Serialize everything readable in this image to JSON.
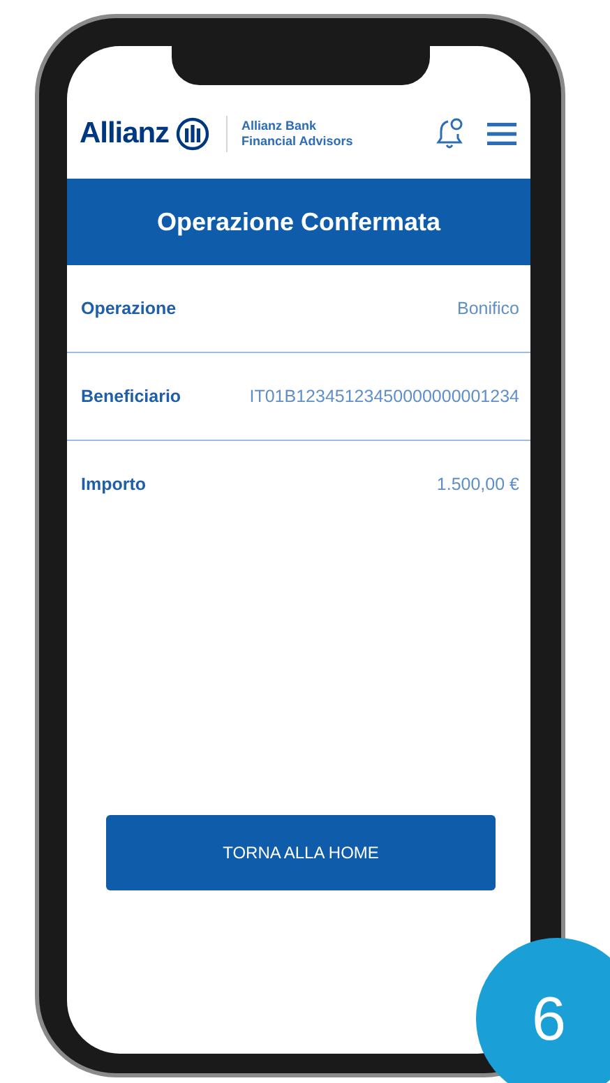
{
  "header": {
    "brand": "Allianz",
    "subbrand": [
      "Allianz Bank",
      "Financial Advisors"
    ]
  },
  "title": "Operazione Confermata",
  "details": [
    {
      "label": "Operazione",
      "value": "Bonifico"
    },
    {
      "label": "Beneficiario",
      "value": "IT01B12345123450000000001234"
    },
    {
      "label": "Importo",
      "value": "1.500,00 €"
    }
  ],
  "button": "TORNA ALLA HOME",
  "step_badge": "6"
}
